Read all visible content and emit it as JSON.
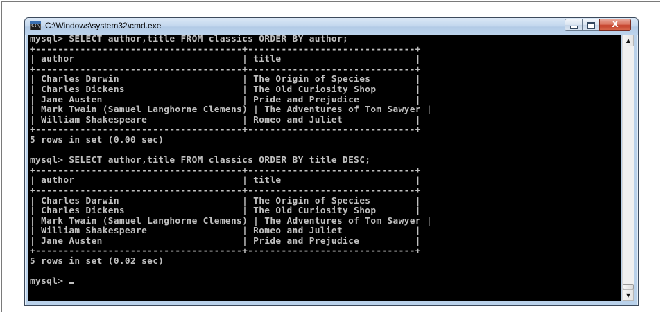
{
  "window": {
    "title": "C:\\Windows\\system32\\cmd.exe",
    "icon": "cmd-icon",
    "icon_text": "C:\\"
  },
  "controls": {
    "minimize_icon": "minimize-icon",
    "maximize_icon": "maximize-icon",
    "close_icon": "close-icon",
    "close_label": "X"
  },
  "colors": {
    "console_bg": "#000000",
    "console_fg": "#c0c0c0",
    "close_red": "#c4412b"
  },
  "console": {
    "lines": [
      "mysql> SELECT author,title FROM classics ORDER BY author;",
      "+-------------------------------------+------------------------------+",
      "| author                              | title                        |",
      "+-------------------------------------+------------------------------+",
      "| Charles Darwin                      | The Origin of Species        |",
      "| Charles Dickens                     | The Old Curiosity Shop       |",
      "| Jane Austen                         | Pride and Prejudice          |",
      "| Mark Twain (Samuel Langhorne Clemens) | The Adventures of Tom Sawyer |",
      "| William Shakespeare                 | Romeo and Juliet             |",
      "+-------------------------------------+------------------------------+",
      "5 rows in set (0.00 sec)",
      "",
      "mysql> SELECT author,title FROM classics ORDER BY title DESC;",
      "+-------------------------------------+------------------------------+",
      "| author                              | title                        |",
      "+-------------------------------------+------------------------------+",
      "| Charles Darwin                      | The Origin of Species        |",
      "| Charles Dickens                     | The Old Curiosity Shop       |",
      "| Mark Twain (Samuel Langhorne Clemens) | The Adventures of Tom Sawyer |",
      "| William Shakespeare                 | Romeo and Juliet             |",
      "| Jane Austen                         | Pride and Prejudice          |",
      "+-------------------------------------+------------------------------+",
      "5 rows in set (0.02 sec)",
      "",
      "mysql> "
    ]
  },
  "scrollbar": {
    "up_icon": "scroll-up-arrow-icon",
    "down_icon": "scroll-down-arrow-icon",
    "position": 1.0
  }
}
